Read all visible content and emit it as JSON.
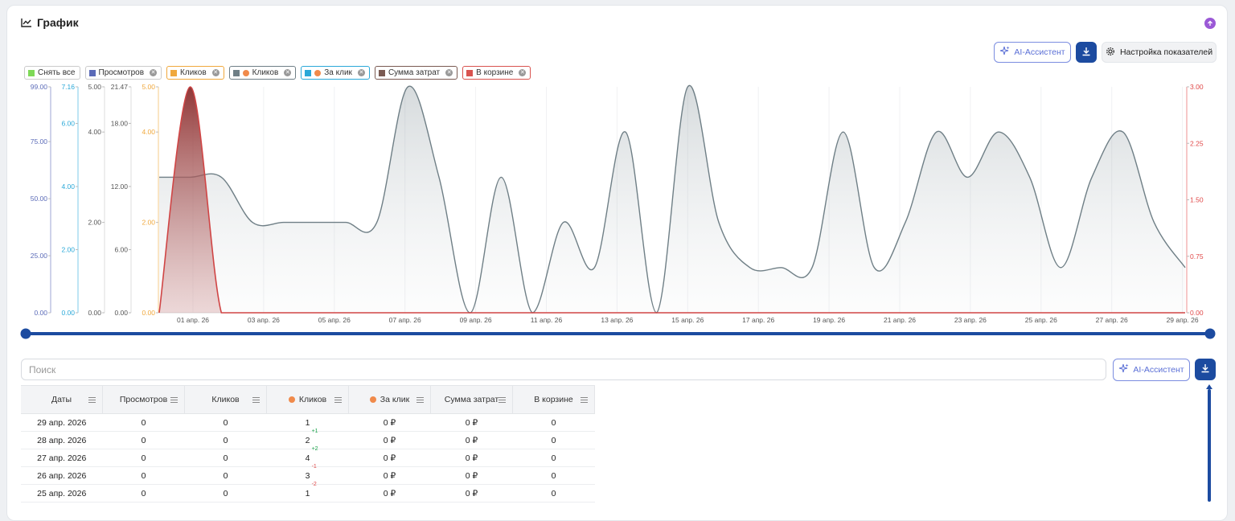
{
  "header": {
    "title": "График"
  },
  "toolbar": {
    "ai_label": "AI-Ассистент",
    "settings_label": "Настройка показателей"
  },
  "legend": {
    "select_all": "Снять все",
    "items": [
      {
        "label": "Просмотров",
        "color": "#5b6bb8",
        "dot": false
      },
      {
        "label": "Кликов",
        "color": "#f0a83c",
        "dot": false
      },
      {
        "label": "Кликов",
        "color": "#6f7f86",
        "dot": true
      },
      {
        "label": "За клик",
        "color": "#2aa8d8",
        "dot": true
      },
      {
        "label": "Сумма затрат",
        "color": "#7a5a52",
        "dot": false
      },
      {
        "label": "В корзине",
        "color": "#d9534f",
        "dot": false
      }
    ]
  },
  "chart_data": {
    "type": "area",
    "x_labels": [
      "01 апр. 26",
      "03 апр. 26",
      "05 апр. 26",
      "07 апр. 26",
      "09 апр. 26",
      "11 апр. 26",
      "13 апр. 26",
      "15 апр. 26",
      "17 апр. 26",
      "19 апр. 26",
      "21 апр. 26",
      "23 апр. 26",
      "25 апр. 26",
      "27 апр. 26",
      "29 апр. 26"
    ],
    "y_axes": [
      {
        "color": "#5b6bb8",
        "ticks": [
          "99.00",
          "75.00",
          "50.00",
          "25.00",
          "0.00"
        ]
      },
      {
        "color": "#2aa8d8",
        "ticks": [
          "7.16",
          "6.00",
          "4.00",
          "2.00",
          "0.00"
        ]
      },
      {
        "color": "#555555",
        "ticks": [
          "5.00",
          "4.00",
          "2.00",
          "0.00"
        ]
      },
      {
        "color": "#555555",
        "ticks": [
          "21.47",
          "18.00",
          "12.00",
          "6.00",
          "0.00"
        ]
      },
      {
        "color": "#f0a83c",
        "ticks": [
          "5.00",
          "4.00",
          "2.00",
          "0.00"
        ]
      },
      {
        "color": "#e04848",
        "ticks": [
          "3.00",
          "2.25",
          "1.50",
          "0.75",
          "0.00"
        ]
      }
    ],
    "series": [
      {
        "name": "Кликов",
        "color": "#6f7f86",
        "values": [
          3,
          3,
          3,
          2,
          2,
          2,
          2,
          2,
          5,
          3,
          0,
          3,
          0,
          2,
          1,
          4,
          0,
          5,
          2,
          1,
          1,
          1,
          4,
          1,
          2,
          4,
          3,
          4,
          3,
          1,
          3,
          4,
          2,
          1
        ]
      },
      {
        "name": "В корзине",
        "color": "#b04040",
        "values": [
          0,
          3,
          0,
          0,
          0,
          0,
          0,
          0,
          0,
          0,
          0,
          0,
          0,
          0,
          0,
          0,
          0,
          0,
          0,
          0,
          0,
          0,
          0,
          0,
          0,
          0,
          0,
          0,
          0,
          0,
          0,
          0,
          0,
          0
        ]
      }
    ]
  },
  "table": {
    "search_placeholder": "Поиск",
    "ai_label": "AI-Ассистент",
    "columns": [
      "Даты",
      "Просмотров",
      "Кликов",
      "Кликов",
      "За клик",
      "Сумма затрат",
      "В корзине"
    ],
    "rows": [
      {
        "date": "29 апр. 2026",
        "views": "0",
        "clicks": "0",
        "clicks2": "1",
        "delta": "",
        "per_click": "0 ₽",
        "cost": "0 ₽",
        "cart": "0"
      },
      {
        "date": "28 апр. 2026",
        "views": "0",
        "clicks": "0",
        "clicks2": "2",
        "delta": "+1",
        "per_click": "0 ₽",
        "cost": "0 ₽",
        "cart": "0"
      },
      {
        "date": "27 апр. 2026",
        "views": "0",
        "clicks": "0",
        "clicks2": "4",
        "delta": "+2",
        "per_click": "0 ₽",
        "cost": "0 ₽",
        "cart": "0"
      },
      {
        "date": "26 апр. 2026",
        "views": "0",
        "clicks": "0",
        "clicks2": "3",
        "delta": "-1",
        "per_click": "0 ₽",
        "cost": "0 ₽",
        "cart": "0"
      },
      {
        "date": "25 апр. 2026",
        "views": "0",
        "clicks": "0",
        "clicks2": "1",
        "delta": "-2",
        "per_click": "0 ₽",
        "cost": "0 ₽",
        "cart": "0"
      }
    ]
  }
}
